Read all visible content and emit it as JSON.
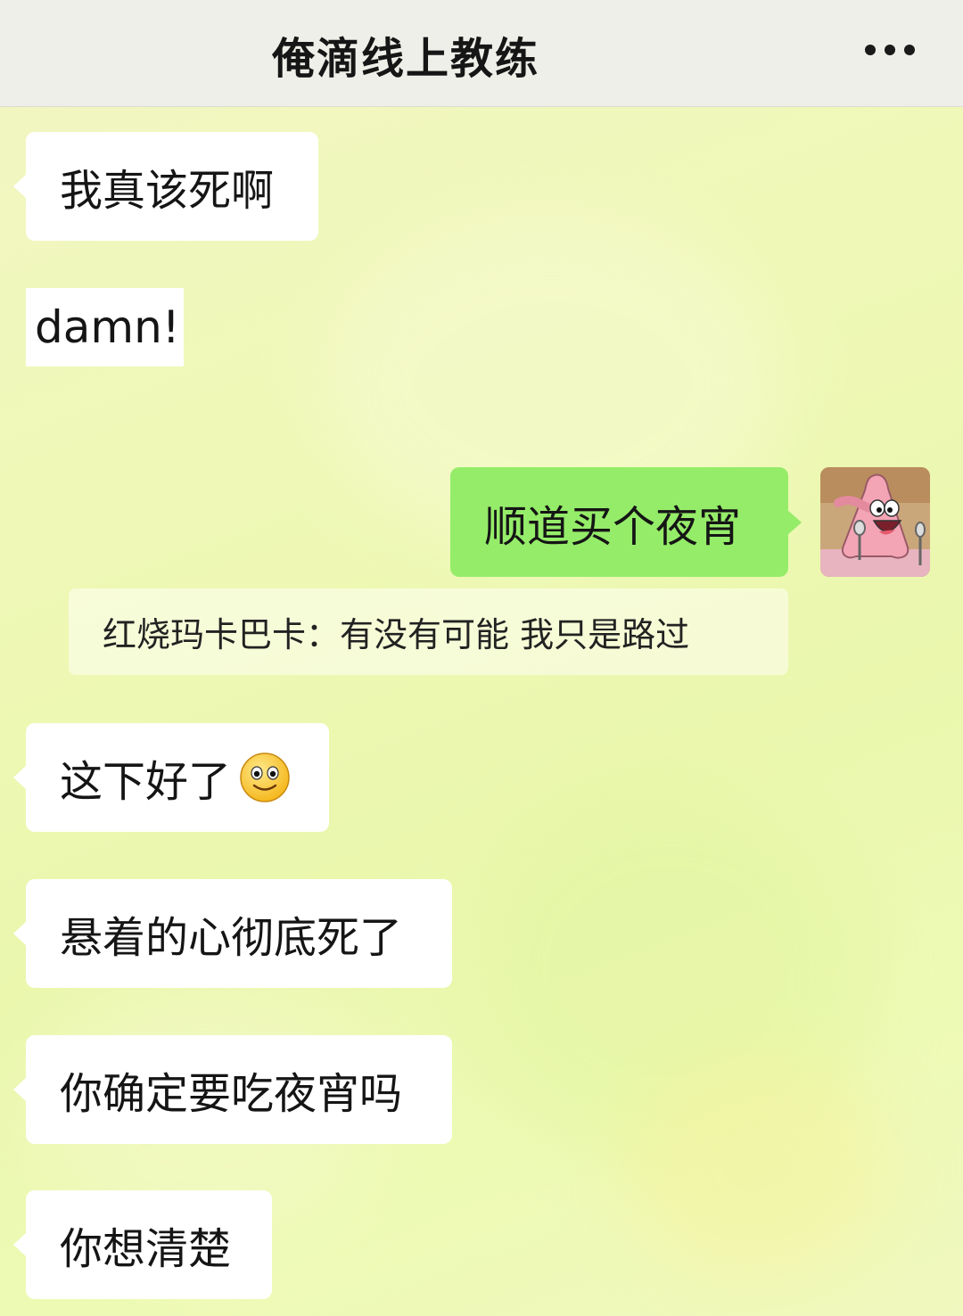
{
  "header": {
    "title": "俺滴线上教练",
    "more_icon": "more-dots-icon"
  },
  "messages": [
    {
      "side": "left",
      "text": "我真该死啊"
    },
    {
      "side": "left",
      "text": "damn!"
    },
    {
      "side": "right",
      "text": "顺道买个夜宵",
      "avatar": "patrick-star-avatar"
    },
    {
      "side": "quote",
      "text": "红烧玛卡巴卡：有没有可能  我只是路过"
    },
    {
      "side": "left",
      "text": "这下好了",
      "emoji": "smile-emoji-icon"
    },
    {
      "side": "left",
      "text": "悬着的心彻底死了"
    },
    {
      "side": "left",
      "text": "你确定要吃夜宵吗"
    },
    {
      "side": "left",
      "text": "你想清楚"
    }
  ],
  "colors": {
    "sent_bubble": "#95ec69",
    "received_bubble": "#ffffff",
    "header_bg": "#efefe9"
  }
}
